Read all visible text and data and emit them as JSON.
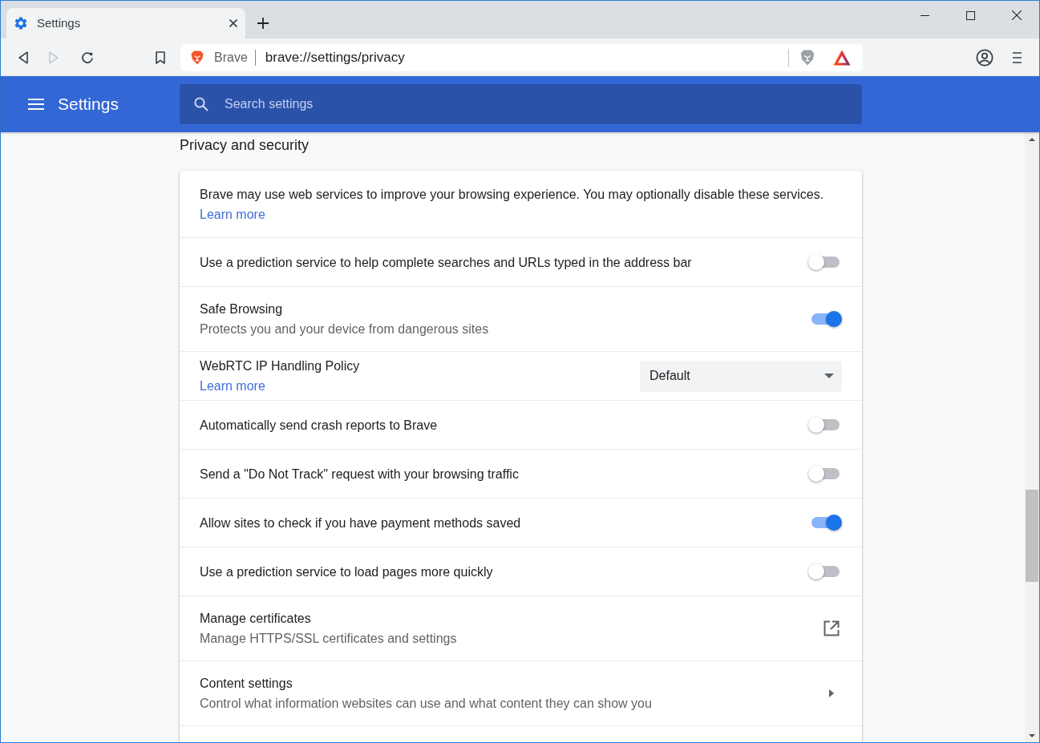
{
  "tabs": [
    {
      "label": "Settings",
      "selected": true
    }
  ],
  "toolbar": {
    "buttons": [
      {
        "kind": "back",
        "disabled": false
      },
      {
        "kind": "forward",
        "disabled": true
      },
      {
        "kind": "reload",
        "disabled": false
      }
    ]
  },
  "address_bar": {
    "site_label": "Brave",
    "url": "brave://settings/privacy"
  },
  "header": {
    "title": "Settings",
    "search": {
      "placeholder": "Search settings"
    }
  },
  "section": {
    "title": "Privacy and security",
    "rows": [
      {
        "kind": "intro",
        "text": "Brave may use web services to improve your browsing experience. You may optionally disable these services.",
        "link": "Learn more"
      },
      {
        "kind": "toggle",
        "label": "Use a prediction service to help complete searches and URLs typed in the address bar",
        "on": false
      },
      {
        "kind": "toggle",
        "label": "Safe Browsing",
        "description": "Protects you and your device from dangerous sites",
        "on": true
      },
      {
        "kind": "dropdown",
        "label": "WebRTC IP Handling Policy",
        "link": "Learn more",
        "value": "Default"
      },
      {
        "kind": "toggle",
        "label": "Automatically send crash reports to Brave",
        "on": false
      },
      {
        "kind": "toggle",
        "label": "Send a \"Do Not Track\" request with your browsing traffic",
        "on": false
      },
      {
        "kind": "toggle",
        "label": "Allow sites to check if you have payment methods saved",
        "on": true
      },
      {
        "kind": "toggle",
        "label": "Use a prediction service to load pages more quickly",
        "on": false
      },
      {
        "kind": "external",
        "label": "Manage certificates",
        "description": "Manage HTTPS/SSL certificates and settings"
      },
      {
        "kind": "subpage",
        "label": "Content settings",
        "description": "Control what information websites can use and what content they can show you"
      }
    ]
  }
}
